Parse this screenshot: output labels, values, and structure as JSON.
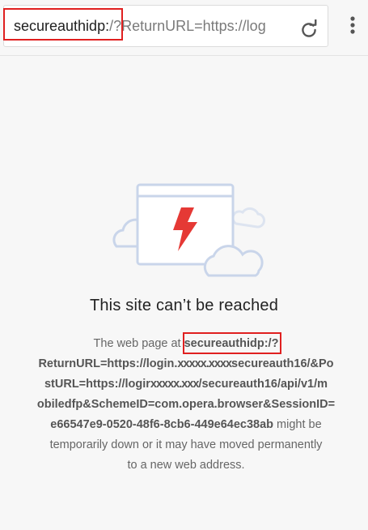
{
  "address_bar": {
    "url_highlighted": "secureauthidp:",
    "url_rest": "/?ReturnURL=https://log",
    "reload_icon": "reload-icon",
    "menu_icon": "overflow-menu-icon"
  },
  "error": {
    "illustration_icon": "broken-page-cloud-icon",
    "title": "This site can’t be reached",
    "prefix": "The web page at",
    "url_highlighted": "secureauthidp:",
    "url_line1_a": "/?",
    "url_line2_a": "ReturnURL=https://login.",
    "url_line2_blur": "xxxxx.xxxx",
    "url_line2_b": "secureauth16/&Po",
    "url_line3_a": "stURL=https://logir",
    "url_line3_blur": "xxxxx.xxx",
    "url_line3_b": "/secureauth16/api/v1/m",
    "url_line4": "obiledfp&SchemeID=com.opera.browser&SessionID=",
    "url_line5": "e66547e9-0520-48f6-8cb6-449e64ec38ab",
    "suffix_a": " might be",
    "suffix_b": "temporarily down or it may have moved permanently",
    "suffix_c": "to a new web address."
  },
  "colors": {
    "highlight_border": "#e02020",
    "illustration_accent": "#e53935",
    "illustration_line": "#c9d5ea"
  }
}
